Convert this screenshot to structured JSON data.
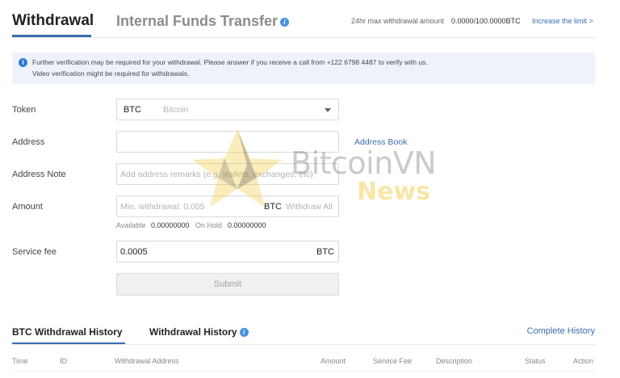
{
  "tabs": {
    "withdrawal": "Withdrawal",
    "internal_transfer": "Internal Funds Transfer",
    "limit_label": "24hr max withdrawal amount",
    "limit_value": "0.0000/100.0000BTC",
    "increase_limit": "Increase the limit >"
  },
  "notice": {
    "line1": "Further verification may be required for your withdrawal. Please answer if you receive a call from +122 6798 4487 to verify with us.",
    "line2": "Video verification might be required for withdrawals."
  },
  "form": {
    "token_label": "Token",
    "token_symbol": "BTC",
    "token_name": "Bitcoin",
    "address_label": "Address",
    "address_value": "",
    "address_book": "Address Book",
    "note_label": "Address Note",
    "note_placeholder": "Add address remarks (e.g. wallets, exchanges, etc)",
    "amount_label": "Amount",
    "amount_placeholder": "Min. withdrawal: 0.005",
    "amount_unit": "BTC",
    "withdraw_all": "Withdraw All",
    "available_label": "Available",
    "available_value": "0.00000000",
    "on_hold_label": "On Hold",
    "on_hold_value": "0.00000000",
    "fee_label": "Service fee",
    "fee_value": "0.0005",
    "fee_unit": "BTC",
    "submit": "Submit"
  },
  "watermark": {
    "text1": "BitcoinVN",
    "text2": "News"
  },
  "history": {
    "tab_btc": "BTC Withdrawal History",
    "tab_all": "Withdrawal History",
    "complete": "Complete History",
    "columns": [
      "Time",
      "ID",
      "Withdrawal Address",
      "Amount",
      "Service Fee",
      "Description",
      "Status",
      "Action"
    ]
  },
  "colors": {
    "accent": "#3a6dad",
    "info": "#2f7bd6",
    "notice_bg": "#eef3fb"
  }
}
